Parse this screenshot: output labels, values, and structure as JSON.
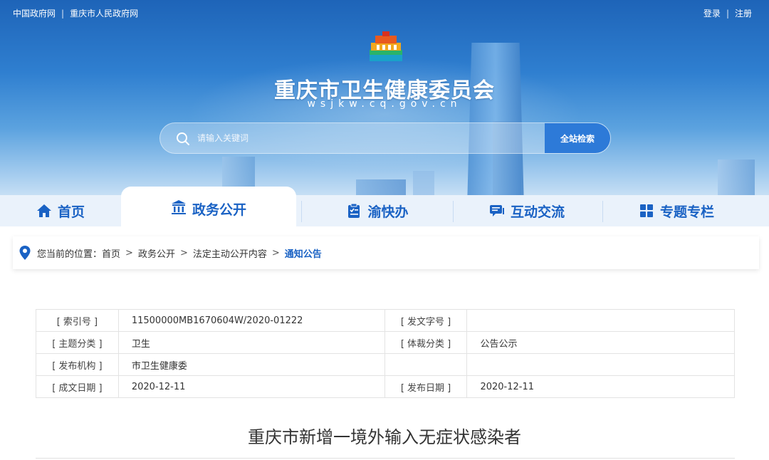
{
  "top_links": {
    "left": [
      "中国政府网",
      "重庆市人民政府网"
    ],
    "separator": "|",
    "right": [
      "登录",
      "注册"
    ]
  },
  "site": {
    "title": "重庆市卫生健康委员会",
    "domain": "wsjkw.cq.gov.cn"
  },
  "search": {
    "placeholder": "请输入关键词",
    "button_label": "全站检索"
  },
  "nav": {
    "tabs": [
      {
        "label": "首页",
        "icon": "home-icon",
        "active": false
      },
      {
        "label": "政务公开",
        "icon": "government-building-icon",
        "active": true
      },
      {
        "label": "渝快办",
        "icon": "clipboard-icon",
        "active": false
      },
      {
        "label": "互动交流",
        "icon": "chat-icon",
        "active": false
      },
      {
        "label": "专题专栏",
        "icon": "grid-icon",
        "active": false
      }
    ]
  },
  "breadcrumb": {
    "prefix": "您当前的位置：",
    "items": [
      "首页",
      "政务公开",
      "法定主动公开内容",
      "通知公告"
    ],
    "separator": ">"
  },
  "meta": {
    "rows": [
      [
        {
          "label": "[ 索引号 ]",
          "value": "11500000MB1670604W/2020-01222"
        },
        {
          "label": "[ 发文字号 ]",
          "value": ""
        }
      ],
      [
        {
          "label": "[ 主题分类 ]",
          "value": "卫生"
        },
        {
          "label": "[ 体裁分类 ]",
          "value": "公告公示"
        }
      ],
      [
        {
          "label": "[ 发布机构 ]",
          "value": "市卫生健康委"
        },
        {
          "label": "",
          "value": ""
        }
      ],
      [
        {
          "label": "[ 成文日期 ]",
          "value": "2020-12-11"
        },
        {
          "label": "[ 发布日期 ]",
          "value": "2020-12-11"
        }
      ]
    ]
  },
  "article": {
    "title": "重庆市新增一境外输入无症状感染者"
  },
  "colors": {
    "primary": "#1a62c4",
    "search_button": "#2d7ad8",
    "nav_bg": "#eaf2fb"
  }
}
